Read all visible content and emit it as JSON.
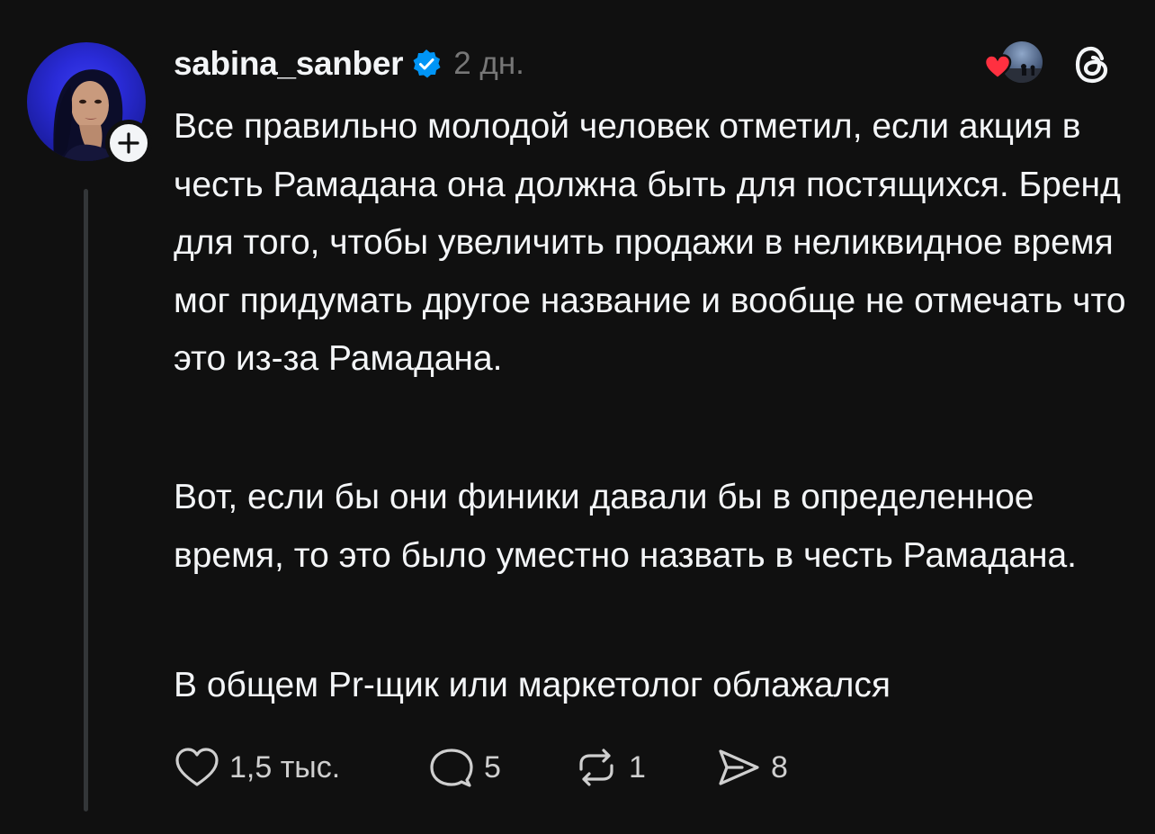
{
  "post": {
    "username": "sabina_sanber",
    "verified": true,
    "time": "2 дн.",
    "paragraphs": [
      "Все правильно молодой человек отметил, если акция в честь Рамадана она должна быть для постящихся. Бренд для того, чтобы увеличить продажи в неликвидное время мог придумать другое название и вообще не отмечать что это из-за Рамадана.",
      "Вот, если бы они финики давали бы в определенное время, то это было уместно назвать в честь Рамадана.",
      "В общем Pr-щик или маркетолог облажался"
    ],
    "actions": {
      "likes": "1,5 тыс.",
      "replies": "5",
      "reposts": "1",
      "shares": "8"
    }
  },
  "icons": {
    "follow": "plus-icon",
    "verified": "verified-badge-icon",
    "liked": "heart-icon",
    "app": "threads-logo-icon",
    "like": "heart-outline-icon",
    "reply": "comment-bubble-icon",
    "repost": "repost-arrows-icon",
    "share": "send-paper-plane-icon"
  },
  "colors": {
    "background": "#101010",
    "text": "#f3f5f7",
    "muted": "#777777",
    "verified": "#0095f6",
    "heart": "#ff3040"
  }
}
